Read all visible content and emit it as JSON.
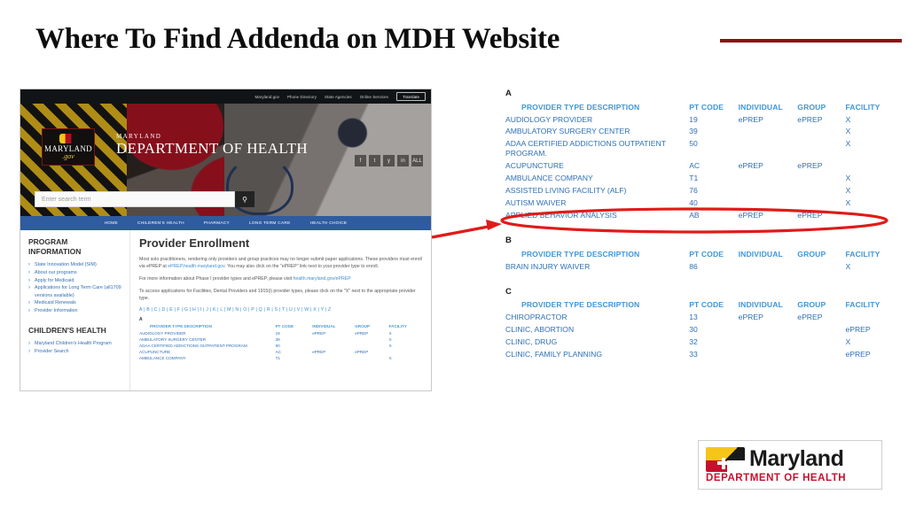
{
  "slide": {
    "title": "Where To Find Addenda on MDH Website",
    "accent_color": "#8b1014"
  },
  "website_screenshot": {
    "topbar": {
      "links": [
        "Maryland.gov",
        "Phone Directory",
        "State Agencies",
        "Online Services"
      ],
      "translate_label": "Translate"
    },
    "brand": {
      "logo_state": "MARYLAND",
      "logo_gov": ".gov",
      "dept_small": "MARYLAND",
      "dept_large": "DEPARTMENT OF HEALTH"
    },
    "social": [
      "f",
      "t",
      "y",
      "in",
      "ALL"
    ],
    "search": {
      "placeholder": "Enter search term",
      "button_icon": "search-icon"
    },
    "nav": [
      "HOME",
      "CHILDREN'S HEALTH",
      "PHARMACY",
      "LONG TERM CARE",
      "HEALTH CHOICE"
    ],
    "sidebar": {
      "heading1": "PROGRAM INFORMATION",
      "items1": [
        "State Innovation Model (SIM)",
        "About our programs",
        "Apply for Medicaid",
        "Applications for Long Term Care (all1709 versions available)",
        "Medicaid Renewals",
        "Provider Information"
      ],
      "heading2": "CHILDREN'S HEALTH",
      "items2": [
        "Maryland Children's Health Program",
        "Provider Search"
      ]
    },
    "main": {
      "heading": "Provider Enrollment",
      "para1a": "Most solo practitioners, rendering only providers and group practices may no longer submit paper applications. These providers must enroll via ePREP at ",
      "para1_link": "ePREP.health.maryland.gov",
      "para1b": ". You may also click on the \"ePREP\" link next to your provider type to enroll.",
      "para2a": "For more information about Phase I provider types and ePREP, please visit ",
      "para2_link": "health.maryland.gov/ePREP",
      "para3": "To access applications for Facilities, Dental Providers and 1915(i) provider types, please click on the \"X\" next to the appropriate provider type.",
      "alphabet": "A | B | C | D | E | F | G | H | I | J | K | L | M | N | O | P | Q | R | S | T | U | V | W | X | Y | Z",
      "section_letter": "A",
      "columns": [
        "PROVIDER TYPE DESCRIPTION",
        "PT CODE",
        "INDIVIDUAL",
        "GROUP",
        "FACILITY"
      ],
      "rows": [
        [
          "AUDIOLOGY PROVIDER",
          "19",
          "ePREP",
          "ePREP",
          "X"
        ],
        [
          "AMBULATORY SURGERY CENTER",
          "39",
          "",
          "",
          "X"
        ],
        [
          "ADAA CERTIFIED ADDICTIONS OUTPATIENT PROGRAM.",
          "50",
          "",
          "",
          "X"
        ],
        [
          "ACUPUNCTURE",
          "AC",
          "ePREP",
          "ePREP",
          ""
        ],
        [
          "AMBULANCE COMPANY",
          "T1",
          "",
          "",
          "X"
        ]
      ]
    }
  },
  "addenda_table": {
    "columns": [
      "PROVIDER TYPE DESCRIPTION",
      "PT CODE",
      "INDIVIDUAL",
      "GROUP",
      "FACILITY"
    ],
    "sections": [
      {
        "letter": "A",
        "rows": [
          [
            "AUDIOLOGY PROVIDER",
            "19",
            "ePREP",
            "ePREP",
            "X"
          ],
          [
            "AMBULATORY SURGERY CENTER",
            "39",
            "",
            "",
            "X"
          ],
          [
            "ADAA CERTIFIED ADDICTIONS OUTPATIENT PROGRAM.",
            "50",
            "",
            "",
            "X"
          ],
          [
            "ACUPUNCTURE",
            "AC",
            "ePREP",
            "ePREP",
            ""
          ],
          [
            "AMBULANCE COMPANY",
            "T1",
            "",
            "",
            "X"
          ],
          [
            "ASSISTED LIVING FACILITY (ALF)",
            "76",
            "",
            "",
            "X"
          ],
          [
            "AUTISM WAIVER",
            "40",
            "",
            "",
            "X"
          ],
          [
            "APPLIED BEHAVIOR ANALYSIS",
            "AB",
            "ePREP",
            "ePREP",
            ""
          ]
        ]
      },
      {
        "letter": "B",
        "rows": [
          [
            "BRAIN INJURY WAIVER",
            "86",
            "",
            "",
            "X"
          ]
        ]
      },
      {
        "letter": "C",
        "rows": [
          [
            "CHIROPRACTOR",
            "13",
            "ePREP",
            "ePREP",
            ""
          ],
          [
            "CLINIC, ABORTION",
            "30",
            "",
            "",
            "ePREP"
          ],
          [
            "CLINIC, DRUG",
            "32",
            "",
            "",
            "X"
          ],
          [
            "CLINIC, FAMILY PLANNING",
            "33",
            "",
            "",
            "ePREP"
          ]
        ]
      }
    ],
    "highlight": {
      "row_label": "AUTISM WAIVER",
      "color": "#e01b18",
      "shape": "ellipse"
    }
  },
  "footer_logo": {
    "name": "Maryland",
    "subtitle": "DEPARTMENT OF HEALTH",
    "accent_color": "#c8102e"
  }
}
